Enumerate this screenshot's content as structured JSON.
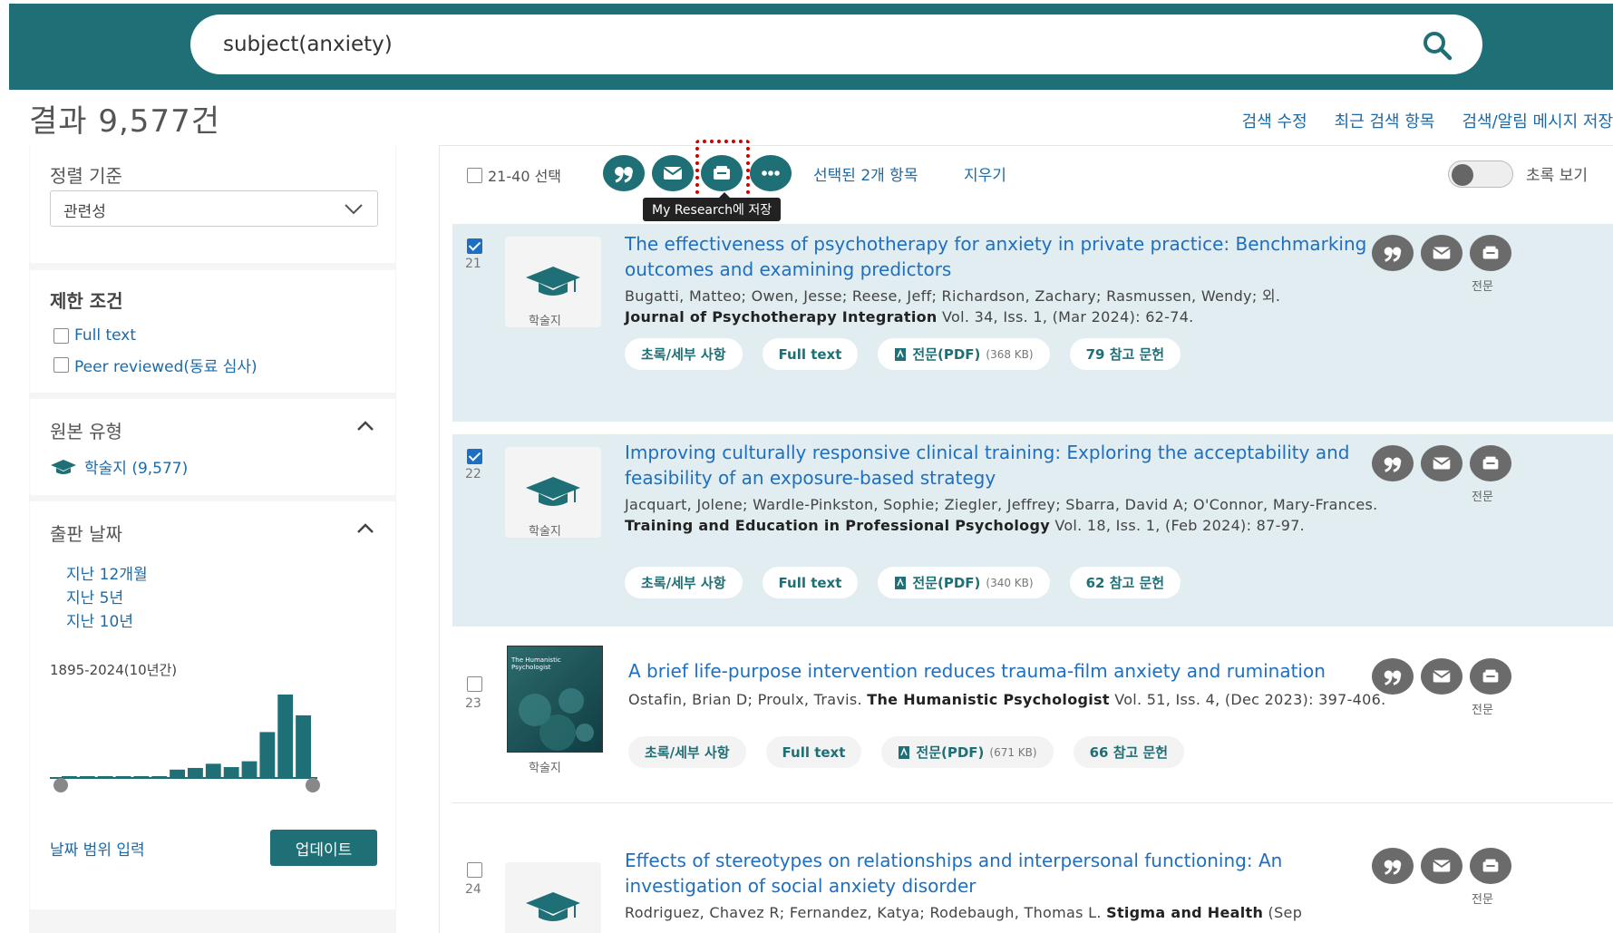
{
  "search": {
    "query": "subject(anxiety)"
  },
  "results_count": "결과 9,577건",
  "top_links": [
    "검색 수정",
    "최근 검색 항목",
    "검색/알림 메시지 저장"
  ],
  "sidebar": {
    "sort_title": "정렬 기준",
    "sort_value": "관련성",
    "limit_title": "제한 조건",
    "limits": [
      "Full text",
      "Peer reviewed(동료 심사)"
    ],
    "source_title": "원본 유형",
    "source_item": "학술지 (9,577)",
    "date_title": "출판 날짜",
    "date_links": [
      "지난 12개월",
      "지난 5년",
      "지난 10년"
    ],
    "date_range": "1895-2024(10년간)",
    "histogram": [
      1,
      1,
      1,
      1,
      1,
      1,
      10,
      12,
      17,
      13,
      20,
      55,
      100,
      75
    ],
    "date_input": "날짜 범위 입력",
    "update_label": "업데이트"
  },
  "toolbar": {
    "select_range": "21-40 선택",
    "tooltip": "My Research에 저장",
    "selected_count": "선택된 2개 항목",
    "clear": "지우기",
    "abstract_toggle": "초록 보기"
  },
  "results": [
    {
      "num": "21",
      "checked": true,
      "type_label": "학술지",
      "title": "The effectiveness of psychotherapy for anxiety in private practice: Benchmarking outcomes and examining predictors",
      "authors": "Bugatti, Matteo; Owen, Jesse; Reese, Jeff; Richardson, Zachary; Rasmussen, Wendy; 외.",
      "journal": "Journal of Psychotherapy Integration",
      "citation": "Vol. 34, Iss. 1,  (Mar 2024): 62-74.",
      "pills": {
        "abstract": "초록/세부 사항",
        "fulltext": "Full text",
        "pdf": "전문(PDF)",
        "pdf_size": "(368 KB)",
        "refs": "79 참고 문헌"
      },
      "fulltext_tag": "전문"
    },
    {
      "num": "22",
      "checked": true,
      "type_label": "학술지",
      "title": "Improving culturally responsive clinical training: Exploring the acceptability and feasibility of an exposure-based strategy",
      "authors": "Jacquart, Jolene; Wardle-Pinkston, Sophie; Ziegler, Jeffrey; Sbarra, David A; O'Connor, Mary-Frances.",
      "journal": "Training and Education in Professional Psychology",
      "citation": "Vol. 18, Iss. 1,  (Feb 2024): 87-97.",
      "pills": {
        "abstract": "초록/세부 사항",
        "fulltext": "Full text",
        "pdf": "전문(PDF)",
        "pdf_size": "(340 KB)",
        "refs": "62 참고 문헌"
      },
      "fulltext_tag": "전문"
    },
    {
      "num": "23",
      "checked": false,
      "type_label": "학술지",
      "cover_title": "The Humanistic Psychologist",
      "title": "A brief life-purpose intervention reduces trauma-film anxiety and rumination",
      "authors": "Ostafin, Brian D; Proulx, Travis.",
      "journal": "The Humanistic Psychologist",
      "citation": "Vol. 51, Iss. 4,  (Dec 2023): 397-406.",
      "pills": {
        "abstract": "초록/세부 사항",
        "fulltext": "Full text",
        "pdf": "전문(PDF)",
        "pdf_size": "(671 KB)",
        "refs": "66 참고 문헌"
      },
      "fulltext_tag": "전문"
    },
    {
      "num": "24",
      "checked": false,
      "title": "Effects of stereotypes on relationships and interpersonal functioning: An investigation of social anxiety disorder",
      "authors": "Rodriguez, Chavez R; Fernandez, Katya; Rodebaugh, Thomas L.",
      "journal": "Stigma and Health",
      "citation": "(Sep",
      "fulltext_tag": "전문"
    }
  ],
  "colors": {
    "header": "#1e6f76",
    "link": "#1d6fc2",
    "selected_row": "#e1edf0",
    "highlight_box": "#cc0000"
  }
}
